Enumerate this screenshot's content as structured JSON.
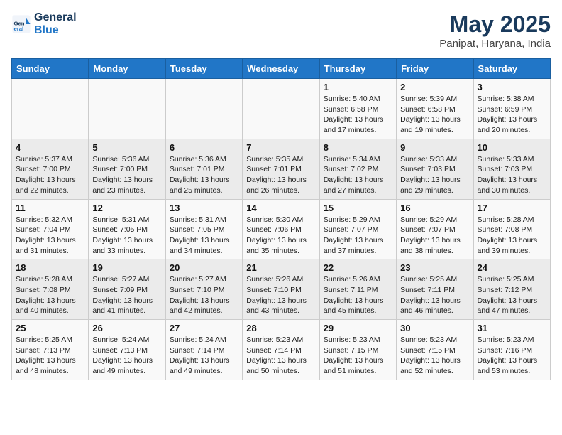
{
  "header": {
    "logo_line1": "General",
    "logo_line2": "Blue",
    "month": "May 2025",
    "location": "Panipat, Haryana, India"
  },
  "weekdays": [
    "Sunday",
    "Monday",
    "Tuesday",
    "Wednesday",
    "Thursday",
    "Friday",
    "Saturday"
  ],
  "weeks": [
    [
      {
        "day": "",
        "info": ""
      },
      {
        "day": "",
        "info": ""
      },
      {
        "day": "",
        "info": ""
      },
      {
        "day": "",
        "info": ""
      },
      {
        "day": "1",
        "info": "Sunrise: 5:40 AM\nSunset: 6:58 PM\nDaylight: 13 hours\nand 17 minutes."
      },
      {
        "day": "2",
        "info": "Sunrise: 5:39 AM\nSunset: 6:58 PM\nDaylight: 13 hours\nand 19 minutes."
      },
      {
        "day": "3",
        "info": "Sunrise: 5:38 AM\nSunset: 6:59 PM\nDaylight: 13 hours\nand 20 minutes."
      }
    ],
    [
      {
        "day": "4",
        "info": "Sunrise: 5:37 AM\nSunset: 7:00 PM\nDaylight: 13 hours\nand 22 minutes."
      },
      {
        "day": "5",
        "info": "Sunrise: 5:36 AM\nSunset: 7:00 PM\nDaylight: 13 hours\nand 23 minutes."
      },
      {
        "day": "6",
        "info": "Sunrise: 5:36 AM\nSunset: 7:01 PM\nDaylight: 13 hours\nand 25 minutes."
      },
      {
        "day": "7",
        "info": "Sunrise: 5:35 AM\nSunset: 7:01 PM\nDaylight: 13 hours\nand 26 minutes."
      },
      {
        "day": "8",
        "info": "Sunrise: 5:34 AM\nSunset: 7:02 PM\nDaylight: 13 hours\nand 27 minutes."
      },
      {
        "day": "9",
        "info": "Sunrise: 5:33 AM\nSunset: 7:03 PM\nDaylight: 13 hours\nand 29 minutes."
      },
      {
        "day": "10",
        "info": "Sunrise: 5:33 AM\nSunset: 7:03 PM\nDaylight: 13 hours\nand 30 minutes."
      }
    ],
    [
      {
        "day": "11",
        "info": "Sunrise: 5:32 AM\nSunset: 7:04 PM\nDaylight: 13 hours\nand 31 minutes."
      },
      {
        "day": "12",
        "info": "Sunrise: 5:31 AM\nSunset: 7:05 PM\nDaylight: 13 hours\nand 33 minutes."
      },
      {
        "day": "13",
        "info": "Sunrise: 5:31 AM\nSunset: 7:05 PM\nDaylight: 13 hours\nand 34 minutes."
      },
      {
        "day": "14",
        "info": "Sunrise: 5:30 AM\nSunset: 7:06 PM\nDaylight: 13 hours\nand 35 minutes."
      },
      {
        "day": "15",
        "info": "Sunrise: 5:29 AM\nSunset: 7:07 PM\nDaylight: 13 hours\nand 37 minutes."
      },
      {
        "day": "16",
        "info": "Sunrise: 5:29 AM\nSunset: 7:07 PM\nDaylight: 13 hours\nand 38 minutes."
      },
      {
        "day": "17",
        "info": "Sunrise: 5:28 AM\nSunset: 7:08 PM\nDaylight: 13 hours\nand 39 minutes."
      }
    ],
    [
      {
        "day": "18",
        "info": "Sunrise: 5:28 AM\nSunset: 7:08 PM\nDaylight: 13 hours\nand 40 minutes."
      },
      {
        "day": "19",
        "info": "Sunrise: 5:27 AM\nSunset: 7:09 PM\nDaylight: 13 hours\nand 41 minutes."
      },
      {
        "day": "20",
        "info": "Sunrise: 5:27 AM\nSunset: 7:10 PM\nDaylight: 13 hours\nand 42 minutes."
      },
      {
        "day": "21",
        "info": "Sunrise: 5:26 AM\nSunset: 7:10 PM\nDaylight: 13 hours\nand 43 minutes."
      },
      {
        "day": "22",
        "info": "Sunrise: 5:26 AM\nSunset: 7:11 PM\nDaylight: 13 hours\nand 45 minutes."
      },
      {
        "day": "23",
        "info": "Sunrise: 5:25 AM\nSunset: 7:11 PM\nDaylight: 13 hours\nand 46 minutes."
      },
      {
        "day": "24",
        "info": "Sunrise: 5:25 AM\nSunset: 7:12 PM\nDaylight: 13 hours\nand 47 minutes."
      }
    ],
    [
      {
        "day": "25",
        "info": "Sunrise: 5:25 AM\nSunset: 7:13 PM\nDaylight: 13 hours\nand 48 minutes."
      },
      {
        "day": "26",
        "info": "Sunrise: 5:24 AM\nSunset: 7:13 PM\nDaylight: 13 hours\nand 49 minutes."
      },
      {
        "day": "27",
        "info": "Sunrise: 5:24 AM\nSunset: 7:14 PM\nDaylight: 13 hours\nand 49 minutes."
      },
      {
        "day": "28",
        "info": "Sunrise: 5:23 AM\nSunset: 7:14 PM\nDaylight: 13 hours\nand 50 minutes."
      },
      {
        "day": "29",
        "info": "Sunrise: 5:23 AM\nSunset: 7:15 PM\nDaylight: 13 hours\nand 51 minutes."
      },
      {
        "day": "30",
        "info": "Sunrise: 5:23 AM\nSunset: 7:15 PM\nDaylight: 13 hours\nand 52 minutes."
      },
      {
        "day": "31",
        "info": "Sunrise: 5:23 AM\nSunset: 7:16 PM\nDaylight: 13 hours\nand 53 minutes."
      }
    ]
  ]
}
